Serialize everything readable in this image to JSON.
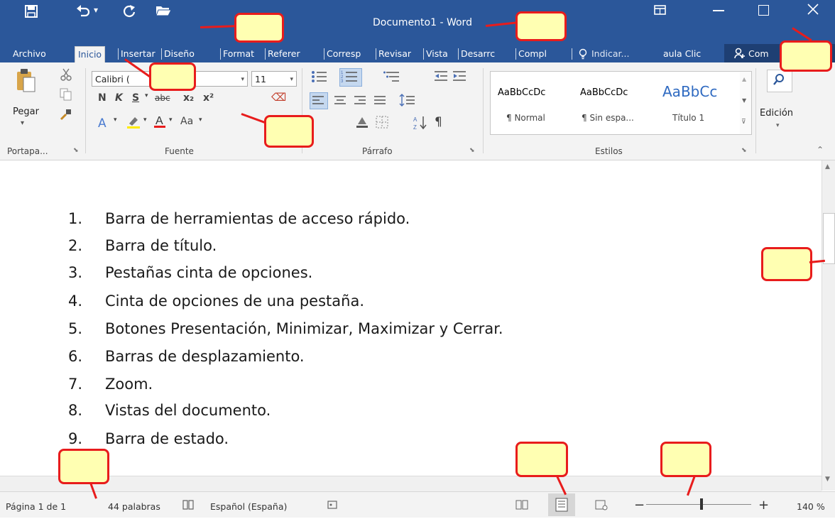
{
  "window": {
    "title": "Documento1 - Word"
  },
  "quick_access": {
    "icons": [
      "save-icon",
      "undo-icon",
      "redo-icon",
      "open-folder-icon"
    ],
    "undo_arrow": "▾"
  },
  "tabs": [
    "Archivo",
    "Inicio",
    "Insertar",
    "Diseño",
    "Format",
    "Referer",
    "Corresp",
    "Revisar",
    "Vista",
    "Desarrc",
    "Compl",
    "Indicar...",
    "aula Clic",
    "Com"
  ],
  "ribbon": {
    "portapapeles": {
      "paste_label": "Pegar",
      "group_label": "Portapa...",
      "launcher": "⬊"
    },
    "fuente": {
      "font_name": "Calibri (",
      "font_size": "11",
      "bold": "N",
      "italic": "K",
      "underline": "S",
      "strike": "abc",
      "subscript": "x₂",
      "superscript": "x²",
      "change_case": "Aa",
      "group_label": "Fuente"
    },
    "parrafo": {
      "group_label": "Párrafo",
      "pilcrow": "¶"
    },
    "estilos": {
      "styles": [
        {
          "preview": "AaBbCcDc",
          "name": "¶ Normal"
        },
        {
          "preview": "AaBbCcDc",
          "name": "¶ Sin espa..."
        },
        {
          "preview": "AaBbCc",
          "name": "Título 1"
        }
      ],
      "group_label": "Estilos"
    },
    "edicion": {
      "label": "Edición"
    }
  },
  "document": {
    "items": [
      {
        "num": "1.",
        "text": "Barra de herramientas de acceso rápido."
      },
      {
        "num": "2.",
        "text": "Barra de título."
      },
      {
        "num": "3.",
        "text": "Pestañas cinta de opciones."
      },
      {
        "num": "4.",
        "text": "Cinta de opciones de una pestaña."
      },
      {
        "num": "5.",
        "text": "Botones  Presentación, Minimizar, Maximizar y Cerrar."
      },
      {
        "num": "6.",
        "text": "Barras de desplazamiento."
      },
      {
        "num": "7.",
        "text": "Zoom."
      },
      {
        "num": "8.",
        "text": "Vistas del documento."
      },
      {
        "num": "9.",
        "text": "Barra de estado."
      }
    ]
  },
  "statusbar": {
    "page": "Página 1 de 1",
    "words": "44 palabras",
    "language": "Español (España)",
    "zoom_minus": "−",
    "zoom_plus": "+",
    "zoom_level": "140 %"
  },
  "colors": {
    "titlebar": "#2b579a",
    "callout_border": "#e81c1c",
    "callout_fill": "#ffffb2"
  }
}
